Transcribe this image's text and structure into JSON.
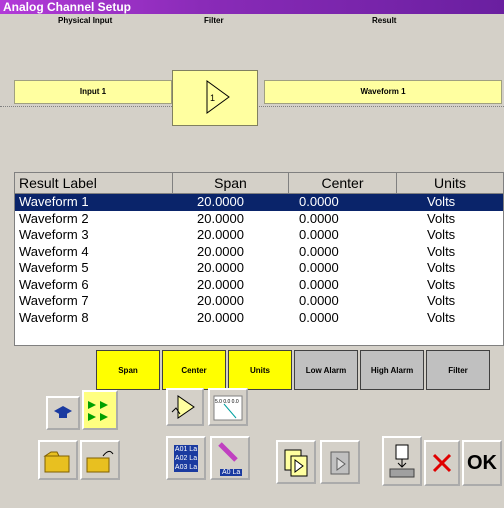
{
  "window": {
    "title": "Analog Channel Setup"
  },
  "diagram": {
    "headers": {
      "physical_input": "Physical Input",
      "filter": "Filter",
      "result": "Result"
    },
    "input_box": "Input 1",
    "filter_label": "1",
    "result_box": "Waveform 1"
  },
  "table": {
    "columns": [
      "Result Label",
      "Span",
      "Center",
      "Units"
    ],
    "rows": [
      {
        "label": "Waveform 1",
        "span": "20.0000",
        "center": "0.0000",
        "units": "Volts",
        "selected": true
      },
      {
        "label": "Waveform 2",
        "span": "20.0000",
        "center": "0.0000",
        "units": "Volts"
      },
      {
        "label": "Waveform 3",
        "span": "20.0000",
        "center": "0.0000",
        "units": "Volts"
      },
      {
        "label": "Waveform 4",
        "span": "20.0000",
        "center": "0.0000",
        "units": "Volts"
      },
      {
        "label": "Waveform 5",
        "span": "20.0000",
        "center": "0.0000",
        "units": "Volts"
      },
      {
        "label": "Waveform 6",
        "span": "20.0000",
        "center": "0.0000",
        "units": "Volts"
      },
      {
        "label": "Waveform 7",
        "span": "20.0000",
        "center": "0.0000",
        "units": "Volts"
      },
      {
        "label": "Waveform 8",
        "span": "20.0000",
        "center": "0.0000",
        "units": "Volts"
      }
    ]
  },
  "tabs": {
    "span": "Span",
    "center": "Center",
    "units": "Units",
    "low_alarm": "Low Alarm",
    "high_alarm": "High Alarm",
    "filter": "Filter"
  },
  "toolbar": {
    "ok": "OK",
    "label_icon_lines": [
      "A01 La",
      "A02 La",
      "A03 La"
    ],
    "edit_icon_text": "A0 La",
    "grid_icon_text": "5.0 0.0 0.0"
  },
  "colors": {
    "title_bar": "#8a2bb8",
    "selected_row": "#0a246a",
    "yellow_tab": "#ffff00",
    "diagram_box": "#ffffa0"
  }
}
